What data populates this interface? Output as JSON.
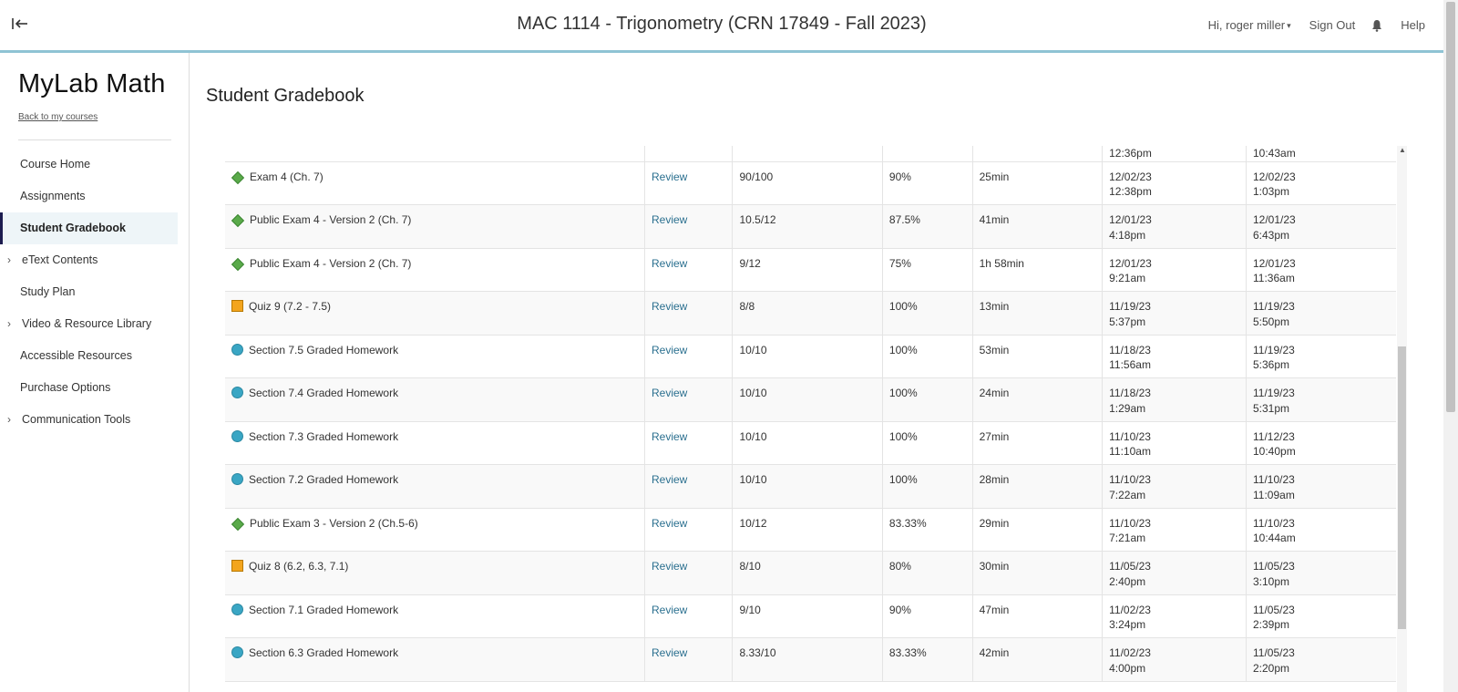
{
  "header": {
    "course_title": "MAC 1114 - Trigonometry (CRN 17849 - Fall 2023)",
    "user_greeting": "Hi, roger miller",
    "sign_out": "Sign Out",
    "help": "Help",
    "accent_color": "#8fc3d4"
  },
  "sidebar": {
    "brand": "MyLab Math",
    "back_link": "Back to my courses",
    "items": [
      {
        "label": "Course Home"
      },
      {
        "label": "Assignments"
      },
      {
        "label": "Student Gradebook"
      },
      {
        "label": "eText Contents"
      },
      {
        "label": "Study Plan"
      },
      {
        "label": "Video & Resource Library"
      },
      {
        "label": "Accessible Resources"
      },
      {
        "label": "Purchase Options"
      },
      {
        "label": "Communication Tools"
      }
    ]
  },
  "main": {
    "page_title": "Student Gradebook",
    "partial_top_row": {
      "start_time": "12:36pm",
      "submitted_time": "10:43am"
    },
    "rows": [
      {
        "icon": "diamond",
        "name": "Exam 4 (Ch. 7)",
        "review": "Review",
        "score": "90/100",
        "percent": "90%",
        "time_spent": "25min",
        "start_date": "12/02/23",
        "start_time": "12:38pm",
        "submitted_date": "12/02/23",
        "submitted_time": "1:03pm"
      },
      {
        "icon": "diamond",
        "name": "Public Exam 4 - Version 2 (Ch. 7)",
        "review": "Review",
        "score": "10.5/12",
        "percent": "87.5%",
        "time_spent": "41min",
        "start_date": "12/01/23",
        "start_time": "4:18pm",
        "submitted_date": "12/01/23",
        "submitted_time": "6:43pm"
      },
      {
        "icon": "diamond",
        "name": "Public Exam 4 - Version 2 (Ch. 7)",
        "review": "Review",
        "score": "9/12",
        "percent": "75%",
        "time_spent": "1h 58min",
        "start_date": "12/01/23",
        "start_time": "9:21am",
        "submitted_date": "12/01/23",
        "submitted_time": "11:36am"
      },
      {
        "icon": "square",
        "name": "Quiz 9 (7.2 - 7.5)",
        "review": "Review",
        "score": "8/8",
        "percent": "100%",
        "time_spent": "13min",
        "start_date": "11/19/23",
        "start_time": "5:37pm",
        "submitted_date": "11/19/23",
        "submitted_time": "5:50pm"
      },
      {
        "icon": "circle",
        "name": "Section 7.5 Graded Homework",
        "review": "Review",
        "score": "10/10",
        "percent": "100%",
        "time_spent": "53min",
        "start_date": "11/18/23",
        "start_time": "11:56am",
        "submitted_date": "11/19/23",
        "submitted_time": "5:36pm"
      },
      {
        "icon": "circle",
        "name": "Section 7.4 Graded Homework",
        "review": "Review",
        "score": "10/10",
        "percent": "100%",
        "time_spent": "24min",
        "start_date": "11/18/23",
        "start_time": "1:29am",
        "submitted_date": "11/19/23",
        "submitted_time": "5:31pm"
      },
      {
        "icon": "circle",
        "name": "Section 7.3 Graded Homework",
        "review": "Review",
        "score": "10/10",
        "percent": "100%",
        "time_spent": "27min",
        "start_date": "11/10/23",
        "start_time": "11:10am",
        "submitted_date": "11/12/23",
        "submitted_time": "10:40pm"
      },
      {
        "icon": "circle",
        "name": "Section 7.2 Graded Homework",
        "review": "Review",
        "score": "10/10",
        "percent": "100%",
        "time_spent": "28min",
        "start_date": "11/10/23",
        "start_time": "7:22am",
        "submitted_date": "11/10/23",
        "submitted_time": "11:09am"
      },
      {
        "icon": "diamond",
        "name": "Public Exam 3 - Version 2 (Ch.5-6)",
        "review": "Review",
        "score": "10/12",
        "percent": "83.33%",
        "time_spent": "29min",
        "start_date": "11/10/23",
        "start_time": "7:21am",
        "submitted_date": "11/10/23",
        "submitted_time": "10:44am"
      },
      {
        "icon": "square",
        "name": "Quiz 8 (6.2, 6.3, 7.1)",
        "review": "Review",
        "score": "8/10",
        "percent": "80%",
        "time_spent": "30min",
        "start_date": "11/05/23",
        "start_time": "2:40pm",
        "submitted_date": "11/05/23",
        "submitted_time": "3:10pm"
      },
      {
        "icon": "circle",
        "name": "Section 7.1 Graded Homework",
        "review": "Review",
        "score": "9/10",
        "percent": "90%",
        "time_spent": "47min",
        "start_date": "11/02/23",
        "start_time": "3:24pm",
        "submitted_date": "11/05/23",
        "submitted_time": "2:39pm"
      },
      {
        "icon": "circle",
        "name": "Section 6.3 Graded Homework",
        "review": "Review",
        "score": "8.33/10",
        "percent": "83.33%",
        "time_spent": "42min",
        "start_date": "11/02/23",
        "start_time": "4:00pm",
        "submitted_date": "11/05/23",
        "submitted_time": "2:20pm"
      }
    ]
  }
}
